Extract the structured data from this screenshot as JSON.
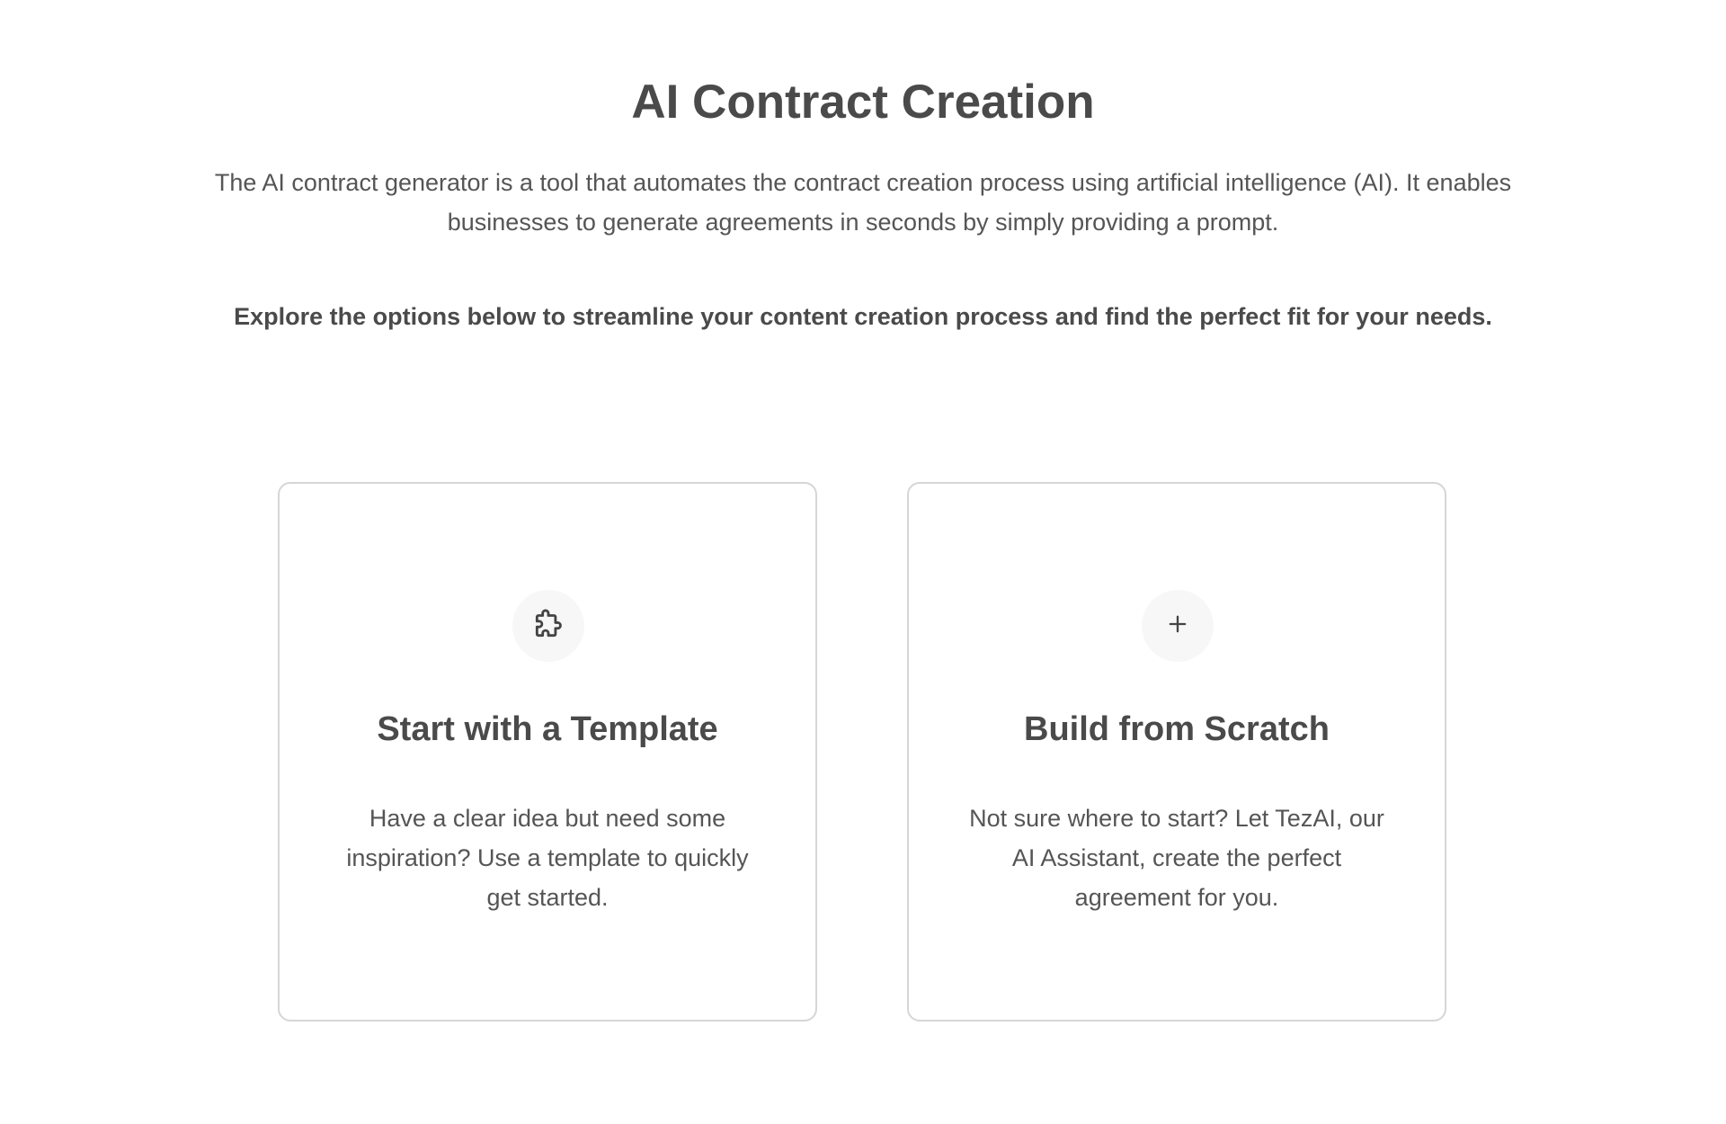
{
  "header": {
    "title": "AI Contract Creation",
    "description": "The AI contract generator is a tool that automates the contract creation process using artificial intelligence (AI). It enables businesses to generate agreements in seconds by simply providing a prompt.",
    "subtitle": "Explore the options below to streamline your content creation process and find the perfect fit for your needs."
  },
  "options": [
    {
      "icon": "puzzle-icon",
      "title": "Start with a Template",
      "text": "Have a clear idea but need some inspiration? Use a template to quickly get started."
    },
    {
      "icon": "plus-icon",
      "title": "Build from Scratch",
      "text": "Not sure where to start? Let TezAI, our AI Assistant, create the perfect agreement for you."
    }
  ],
  "colors": {
    "text": "#4a4a4a",
    "card_border": "#d6d6d6",
    "icon_background": "#f7f7f7"
  }
}
